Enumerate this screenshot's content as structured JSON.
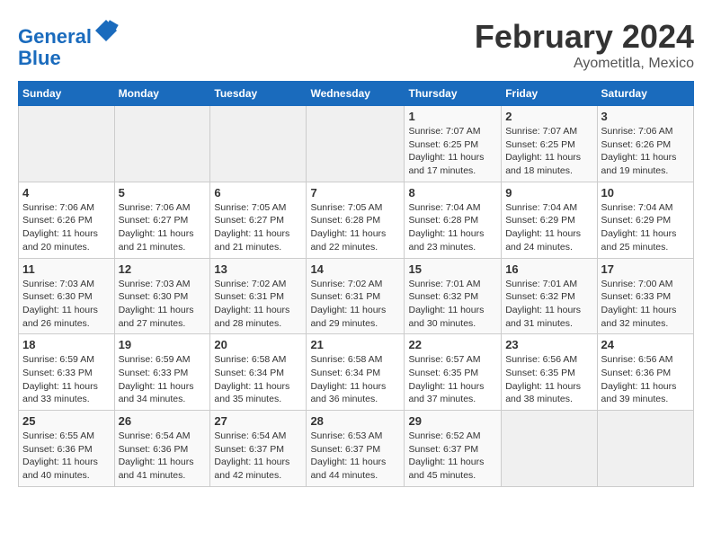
{
  "header": {
    "logo_line1": "General",
    "logo_line2": "Blue",
    "month": "February 2024",
    "location": "Ayometitla, Mexico"
  },
  "weekdays": [
    "Sunday",
    "Monday",
    "Tuesday",
    "Wednesday",
    "Thursday",
    "Friday",
    "Saturday"
  ],
  "weeks": [
    [
      {
        "day": "",
        "info": ""
      },
      {
        "day": "",
        "info": ""
      },
      {
        "day": "",
        "info": ""
      },
      {
        "day": "",
        "info": ""
      },
      {
        "day": "1",
        "info": "Sunrise: 7:07 AM\nSunset: 6:25 PM\nDaylight: 11 hours and 17 minutes."
      },
      {
        "day": "2",
        "info": "Sunrise: 7:07 AM\nSunset: 6:25 PM\nDaylight: 11 hours and 18 minutes."
      },
      {
        "day": "3",
        "info": "Sunrise: 7:06 AM\nSunset: 6:26 PM\nDaylight: 11 hours and 19 minutes."
      }
    ],
    [
      {
        "day": "4",
        "info": "Sunrise: 7:06 AM\nSunset: 6:26 PM\nDaylight: 11 hours and 20 minutes."
      },
      {
        "day": "5",
        "info": "Sunrise: 7:06 AM\nSunset: 6:27 PM\nDaylight: 11 hours and 21 minutes."
      },
      {
        "day": "6",
        "info": "Sunrise: 7:05 AM\nSunset: 6:27 PM\nDaylight: 11 hours and 21 minutes."
      },
      {
        "day": "7",
        "info": "Sunrise: 7:05 AM\nSunset: 6:28 PM\nDaylight: 11 hours and 22 minutes."
      },
      {
        "day": "8",
        "info": "Sunrise: 7:04 AM\nSunset: 6:28 PM\nDaylight: 11 hours and 23 minutes."
      },
      {
        "day": "9",
        "info": "Sunrise: 7:04 AM\nSunset: 6:29 PM\nDaylight: 11 hours and 24 minutes."
      },
      {
        "day": "10",
        "info": "Sunrise: 7:04 AM\nSunset: 6:29 PM\nDaylight: 11 hours and 25 minutes."
      }
    ],
    [
      {
        "day": "11",
        "info": "Sunrise: 7:03 AM\nSunset: 6:30 PM\nDaylight: 11 hours and 26 minutes."
      },
      {
        "day": "12",
        "info": "Sunrise: 7:03 AM\nSunset: 6:30 PM\nDaylight: 11 hours and 27 minutes."
      },
      {
        "day": "13",
        "info": "Sunrise: 7:02 AM\nSunset: 6:31 PM\nDaylight: 11 hours and 28 minutes."
      },
      {
        "day": "14",
        "info": "Sunrise: 7:02 AM\nSunset: 6:31 PM\nDaylight: 11 hours and 29 minutes."
      },
      {
        "day": "15",
        "info": "Sunrise: 7:01 AM\nSunset: 6:32 PM\nDaylight: 11 hours and 30 minutes."
      },
      {
        "day": "16",
        "info": "Sunrise: 7:01 AM\nSunset: 6:32 PM\nDaylight: 11 hours and 31 minutes."
      },
      {
        "day": "17",
        "info": "Sunrise: 7:00 AM\nSunset: 6:33 PM\nDaylight: 11 hours and 32 minutes."
      }
    ],
    [
      {
        "day": "18",
        "info": "Sunrise: 6:59 AM\nSunset: 6:33 PM\nDaylight: 11 hours and 33 minutes."
      },
      {
        "day": "19",
        "info": "Sunrise: 6:59 AM\nSunset: 6:33 PM\nDaylight: 11 hours and 34 minutes."
      },
      {
        "day": "20",
        "info": "Sunrise: 6:58 AM\nSunset: 6:34 PM\nDaylight: 11 hours and 35 minutes."
      },
      {
        "day": "21",
        "info": "Sunrise: 6:58 AM\nSunset: 6:34 PM\nDaylight: 11 hours and 36 minutes."
      },
      {
        "day": "22",
        "info": "Sunrise: 6:57 AM\nSunset: 6:35 PM\nDaylight: 11 hours and 37 minutes."
      },
      {
        "day": "23",
        "info": "Sunrise: 6:56 AM\nSunset: 6:35 PM\nDaylight: 11 hours and 38 minutes."
      },
      {
        "day": "24",
        "info": "Sunrise: 6:56 AM\nSunset: 6:36 PM\nDaylight: 11 hours and 39 minutes."
      }
    ],
    [
      {
        "day": "25",
        "info": "Sunrise: 6:55 AM\nSunset: 6:36 PM\nDaylight: 11 hours and 40 minutes."
      },
      {
        "day": "26",
        "info": "Sunrise: 6:54 AM\nSunset: 6:36 PM\nDaylight: 11 hours and 41 minutes."
      },
      {
        "day": "27",
        "info": "Sunrise: 6:54 AM\nSunset: 6:37 PM\nDaylight: 11 hours and 42 minutes."
      },
      {
        "day": "28",
        "info": "Sunrise: 6:53 AM\nSunset: 6:37 PM\nDaylight: 11 hours and 44 minutes."
      },
      {
        "day": "29",
        "info": "Sunrise: 6:52 AM\nSunset: 6:37 PM\nDaylight: 11 hours and 45 minutes."
      },
      {
        "day": "",
        "info": ""
      },
      {
        "day": "",
        "info": ""
      }
    ]
  ]
}
